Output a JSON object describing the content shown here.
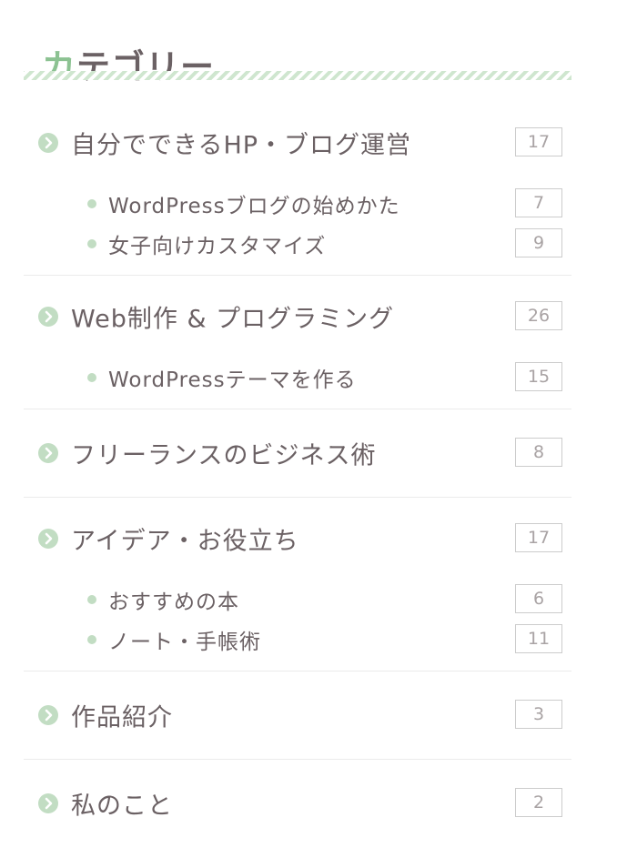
{
  "widget": {
    "title_first": "カ",
    "title_rest": "テゴリー"
  },
  "colors": {
    "accent": "#8cc292",
    "icon": "#c2ddc3",
    "text": "#6b6164",
    "count_text": "#a9a3a4",
    "divider": "#ebebeb"
  },
  "categories": [
    {
      "label": "自分でできるHP・ブログ運営",
      "count": "17",
      "icon": "chevron-circle-right-icon",
      "children": [
        {
          "label": "WordPressブログの始めかた",
          "count": "7"
        },
        {
          "label": "女子向けカスタマイズ",
          "count": "9"
        }
      ]
    },
    {
      "label": "Web制作 & プログラミング",
      "count": "26",
      "icon": "chevron-circle-right-icon",
      "children": [
        {
          "label": "WordPressテーマを作る",
          "count": "15"
        }
      ]
    },
    {
      "label": "フリーランスのビジネス術",
      "count": "8",
      "icon": "chevron-circle-right-icon",
      "children": []
    },
    {
      "label": "アイデア・お役立ち",
      "count": "17",
      "icon": "chevron-circle-right-icon",
      "children": [
        {
          "label": "おすすめの本",
          "count": "6"
        },
        {
          "label": "ノート・手帳術",
          "count": "11"
        }
      ]
    },
    {
      "label": "作品紹介",
      "count": "3",
      "icon": "chevron-circle-right-icon",
      "children": []
    },
    {
      "label": "私のこと",
      "count": "2",
      "icon": "chevron-circle-right-icon",
      "children": []
    }
  ]
}
